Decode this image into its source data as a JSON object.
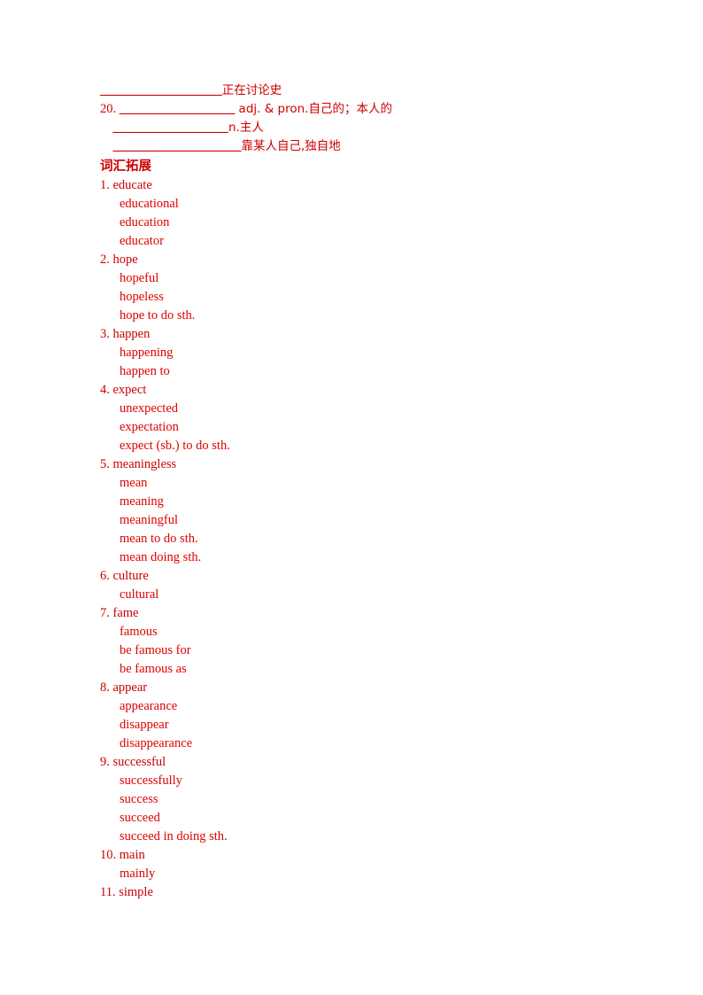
{
  "document": {
    "top_block": {
      "lines": [
        {
          "id": "l1",
          "blank": "___________________",
          "text": "正在讨论史",
          "prefix": "  "
        },
        {
          "id": "l2",
          "prefix": "20. ",
          "blank": "__________________",
          "text": " adj. & pron.自己的；本人的"
        },
        {
          "id": "l3",
          "prefix": "    ",
          "blank": "__________________",
          "text": "n.主人"
        },
        {
          "id": "l4",
          "prefix": "    ",
          "blank": "____________________",
          "text": "靠某人自己,独自地"
        }
      ]
    },
    "section_heading": "词汇拓展",
    "entries": [
      {
        "num": "1.",
        "word": "educate",
        "subs": [
          "educational",
          "education",
          "educator"
        ]
      },
      {
        "num": "2.",
        "word": "hope",
        "subs": [
          "hopeful",
          "hopeless",
          "hope to do sth."
        ]
      },
      {
        "num": "3.",
        "word": "happen",
        "subs": [
          "happening",
          "happen to"
        ]
      },
      {
        "num": "4.",
        "word": "expect",
        "subs": [
          "unexpected",
          "expectation",
          "expect (sb.) to do sth."
        ]
      },
      {
        "num": "5.",
        "word": "meaningless",
        "subs": [
          "mean",
          "meaning",
          "meaningful",
          "mean to do sth.",
          "mean doing sth."
        ]
      },
      {
        "num": "6.",
        "word": "culture",
        "subs": [
          "cultural"
        ]
      },
      {
        "num": "7.",
        "word": "fame",
        "subs": [
          "famous",
          "be famous for",
          "be famous as"
        ]
      },
      {
        "num": "8.",
        "word": "appear",
        "subs": [
          "appearance",
          "disappear",
          "disappearance"
        ]
      },
      {
        "num": "9.",
        "word": "successful",
        "subs": [
          "successfully",
          "success",
          "succeed",
          "succeed in doing sth."
        ]
      },
      {
        "num": "10.",
        "word": "main",
        "subs": [
          "mainly"
        ]
      },
      {
        "num": "11.",
        "word": "simple",
        "subs": []
      }
    ]
  }
}
